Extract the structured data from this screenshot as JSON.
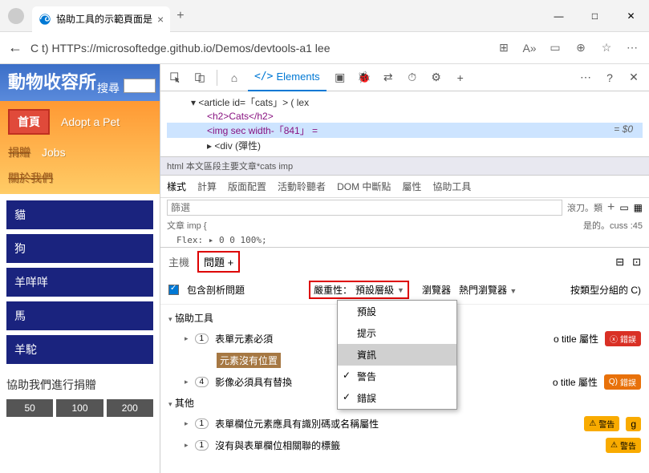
{
  "window": {
    "tab_title": "協助工具的示範頁面是",
    "url": "C t) HTTPs://microsoftedge.github.io/Demos/devtools-a1 lee"
  },
  "win_controls": {
    "min": "—",
    "max": "□",
    "close": "✕"
  },
  "page": {
    "title": "動物收容所",
    "search_label": "搜尋",
    "nav_home": "首頁",
    "nav_adopt": "Adopt a Pet",
    "nav_donate": "捐贈",
    "nav_jobs": "Jobs",
    "nav_about": "關於我們",
    "animals": [
      "貓",
      "狗",
      "羊咩咩",
      "馬",
      "羊駝"
    ],
    "donate_text": "協助我們進行捐贈",
    "amounts": [
      "50",
      "100",
      "200"
    ]
  },
  "devtools": {
    "elements_label": "Elements",
    "dom": {
      "l1": "▾ <article id=「cats」> ( lex",
      "l2": "<h2>Cats</h2>",
      "l3": "<img  sec width-「841」 =",
      "l3_eq": "= $0",
      "l4": "▸ <div (彈性)"
    },
    "crumb": "html 本文區段主要文章*cats imp",
    "styles_tabs": [
      "樣式",
      "計算",
      "版面配置",
      "活動聆聽者",
      "DOM 中斷點",
      "屬性",
      "協助工具"
    ],
    "filter_placeholder": "篩選",
    "filter_right": "滾刀。類",
    "meta_left": "文章 imp {",
    "meta_right": "是的。cuss :45",
    "flex_line": "Flex:    ▸ 0 0 100%;",
    "drawer_host": "主機",
    "drawer_issues": "問題",
    "include_label": "包含剖析問題",
    "severity_label": "嚴重性：",
    "severity_value": "預設層級",
    "browser": "瀏覽器",
    "popular": "熱門瀏覽器",
    "group_by": "按類型分組的 C)",
    "dropdown": {
      "preset": "預設",
      "hint": "提示",
      "info": "資訊",
      "warn": "警告",
      "err": "錯誤"
    },
    "group_a11y": "協助工具",
    "group_other": "其他",
    "issue1": "表單元素必須",
    "issue1b": "元素沒有位置",
    "issue2": "影像必須具有替換",
    "issue3": "表單欄位元素應具有識別碼或名稱屬性",
    "issue4": "沒有與表單欄位相關聯的標籤",
    "title_attr": "o title 屬性",
    "badge_err": "錯誤",
    "badge_q": "錯誤",
    "badge_warn": "警告",
    "badge_g": "g"
  }
}
